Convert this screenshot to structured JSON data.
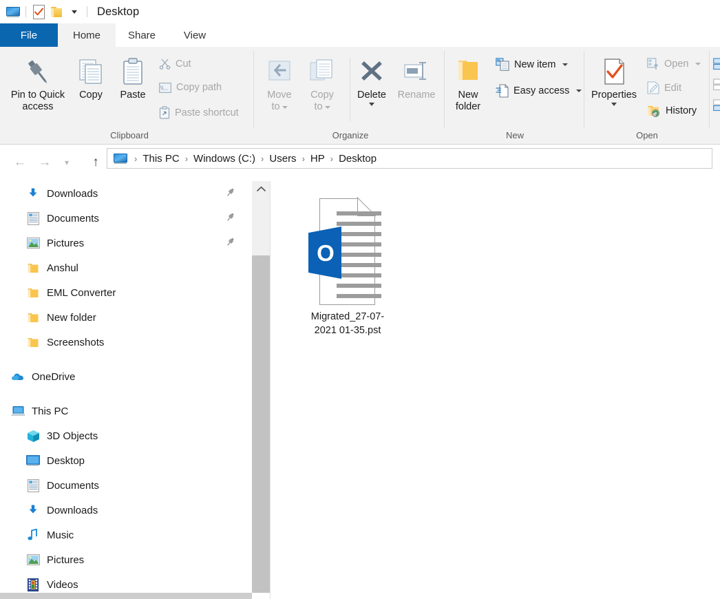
{
  "window": {
    "title": "Desktop",
    "quick_access_toolbar": [
      {
        "name": "desktop-icon",
        "label": "Desktop"
      },
      {
        "name": "properties-icon",
        "label": "Properties"
      },
      {
        "name": "new-folder-icon",
        "label": "New folder"
      },
      {
        "name": "customize-dropdown",
        "label": "Customize Quick Access Toolbar"
      }
    ]
  },
  "tabs": [
    {
      "id": "file",
      "label": "File",
      "active": false
    },
    {
      "id": "home",
      "label": "Home",
      "active": true
    },
    {
      "id": "share",
      "label": "Share",
      "active": false
    },
    {
      "id": "view",
      "label": "View",
      "active": false
    }
  ],
  "ribbon": {
    "groups": [
      {
        "name": "clipboard",
        "label": "Clipboard",
        "big_buttons": [
          {
            "label_line1": "Pin to Quick",
            "label_line2": "access",
            "icon": "pin-icon",
            "disabled": false
          },
          {
            "label_line1": "Copy",
            "label_line2": "",
            "icon": "copy-icon",
            "disabled": false
          },
          {
            "label_line1": "Paste",
            "label_line2": "",
            "icon": "paste-icon",
            "disabled": false
          }
        ],
        "small_buttons": [
          {
            "label": "Cut",
            "icon": "scissors-icon",
            "disabled": true
          },
          {
            "label": "Copy path",
            "icon": "copy-path-icon",
            "disabled": true
          },
          {
            "label": "Paste shortcut",
            "icon": "paste-shortcut-icon",
            "disabled": true
          }
        ]
      },
      {
        "name": "organize",
        "label": "Organize",
        "big_buttons": [
          {
            "label_line1": "Move",
            "label_line2": "to",
            "icon": "move-to-icon",
            "disabled": true,
            "has_caret": true
          },
          {
            "label_line1": "Copy",
            "label_line2": "to",
            "icon": "copy-to-icon",
            "disabled": true,
            "has_caret": true
          },
          {
            "label_line1": "Delete",
            "label_line2": "",
            "icon": "delete-icon",
            "disabled": false,
            "has_caret": true
          },
          {
            "label_line1": "Rename",
            "label_line2": "",
            "icon": "rename-icon",
            "disabled": true
          }
        ]
      },
      {
        "name": "new",
        "label": "New",
        "big_buttons": [
          {
            "label_line1": "New",
            "label_line2": "folder",
            "icon": "new-folder-icon",
            "disabled": false
          }
        ],
        "small_buttons": [
          {
            "label": "New item",
            "icon": "new-item-icon",
            "disabled": false,
            "has_caret": true
          },
          {
            "label": "Easy access",
            "icon": "easy-access-icon",
            "disabled": false,
            "has_caret": true
          }
        ]
      },
      {
        "name": "open",
        "label": "Open",
        "big_buttons": [
          {
            "label_line1": "Properties",
            "label_line2": "",
            "icon": "properties-icon",
            "disabled": false,
            "has_caret": true
          }
        ],
        "small_buttons": [
          {
            "label": "Open",
            "icon": "open-icon",
            "disabled": true,
            "has_caret": true
          },
          {
            "label": "Edit",
            "icon": "edit-icon",
            "disabled": true
          },
          {
            "label": "History",
            "icon": "history-icon",
            "disabled": false
          }
        ]
      },
      {
        "name": "select",
        "label": "",
        "clipped": true
      }
    ]
  },
  "navigation": {
    "back": "Back",
    "forward": "Forward",
    "recent": "Recent locations",
    "up": "Up",
    "breadcrumb": [
      {
        "label": "This PC"
      },
      {
        "label": "Windows (C:)"
      },
      {
        "label": "Users"
      },
      {
        "label": "HP"
      },
      {
        "label": "Desktop"
      }
    ],
    "separator": "›"
  },
  "sidebar": {
    "groups": [
      {
        "name": "quick-access",
        "items": [
          {
            "label": "Downloads",
            "icon": "download-arrow-icon",
            "pinned": true,
            "level": 1
          },
          {
            "label": "Documents",
            "icon": "documents-icon",
            "pinned": true,
            "level": 1
          },
          {
            "label": "Pictures",
            "icon": "pictures-icon",
            "pinned": true,
            "level": 1
          },
          {
            "label": "Anshul",
            "icon": "folder-icon",
            "pinned": false,
            "level": 1
          },
          {
            "label": "EML Converter",
            "icon": "folder-icon",
            "pinned": false,
            "level": 1
          },
          {
            "label": "New folder",
            "icon": "folder-icon",
            "pinned": false,
            "level": 1
          },
          {
            "label": "Screenshots",
            "icon": "folder-icon",
            "pinned": false,
            "level": 1
          }
        ]
      },
      {
        "name": "onedrive",
        "items": [
          {
            "label": "OneDrive",
            "icon": "onedrive-cloud-icon",
            "pinned": false,
            "level": 0
          }
        ]
      },
      {
        "name": "this-pc",
        "items": [
          {
            "label": "This PC",
            "icon": "this-pc-icon",
            "pinned": false,
            "level": 0
          },
          {
            "label": "3D Objects",
            "icon": "3d-objects-icon",
            "pinned": false,
            "level": 1
          },
          {
            "label": "Desktop",
            "icon": "desktop-icon",
            "pinned": false,
            "level": 1
          },
          {
            "label": "Documents",
            "icon": "documents-icon",
            "pinned": false,
            "level": 1
          },
          {
            "label": "Downloads",
            "icon": "download-arrow-icon",
            "pinned": false,
            "level": 1
          },
          {
            "label": "Music",
            "icon": "music-note-icon",
            "pinned": false,
            "level": 1
          },
          {
            "label": "Pictures",
            "icon": "pictures-icon",
            "pinned": false,
            "level": 1
          },
          {
            "label": "Videos",
            "icon": "videos-icon",
            "pinned": false,
            "level": 1
          }
        ]
      }
    ]
  },
  "files": [
    {
      "name": "Migrated_27-07-2021 01-35.pst",
      "icon": "outlook-pst-icon",
      "badge_letter": "O",
      "selected": false
    }
  ],
  "colors": {
    "file_tab_blue": "#0b66b0",
    "ribbon_bg": "#f2f2f2",
    "outlook_blue": "#0a61b5",
    "folder_yellow": "#f0bb3c",
    "accent_blue": "#1e8bd8",
    "disabled_grey": "#a6a6a6"
  }
}
